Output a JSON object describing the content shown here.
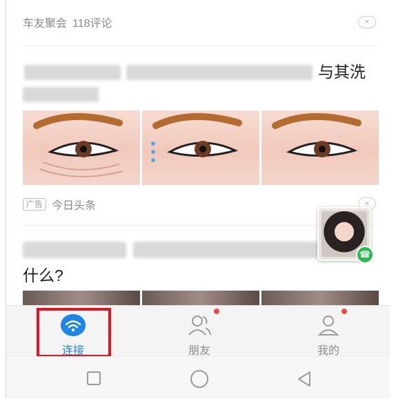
{
  "feed": {
    "card1": {
      "source": "车友聚会",
      "comments": "118评论",
      "close": "×"
    },
    "card2": {
      "headline_visible_tail": "与其洗",
      "ad_label": "广告",
      "source": "今日头条",
      "close": "×"
    },
    "card3": {
      "headline_tail": "什么?"
    }
  },
  "call_bubble": {
    "phone_icon": "phone-icon"
  },
  "tabbar": {
    "tabs": [
      {
        "label": "连接",
        "icon": "wifi-icon",
        "active": true
      },
      {
        "label": "朋友",
        "icon": "friends-icon",
        "badge": true
      },
      {
        "label": "我的",
        "icon": "profile-icon",
        "badge": true
      }
    ],
    "highlight_color": "#e8121e",
    "active_color": "#1e86e8",
    "badge_color": "#f04848"
  },
  "system_nav": {
    "buttons": [
      "square-icon",
      "circle-icon",
      "back-triangle-icon"
    ]
  }
}
